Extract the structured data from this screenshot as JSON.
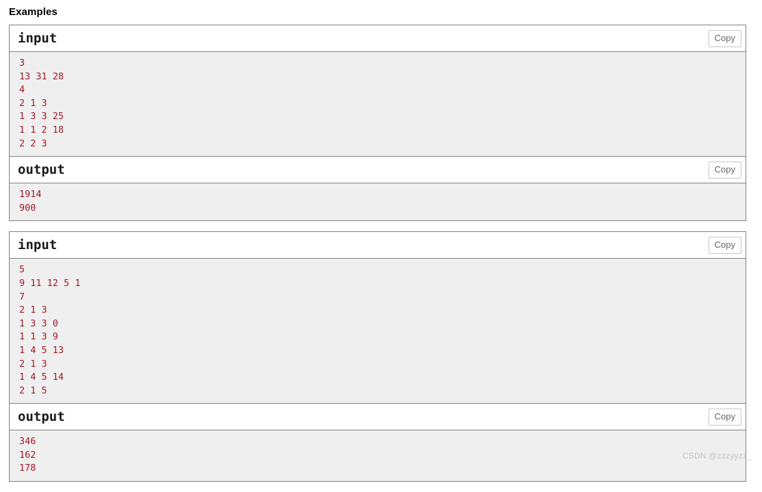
{
  "page": {
    "section_heading": "Examples",
    "watermark": "CSDN @zzzyyzz_"
  },
  "colors": {
    "code_text": "#a01a28",
    "pre_background": "#efefef",
    "panel_border": "#808080",
    "copy_border": "#c8c8c8",
    "copy_text": "#666666",
    "heading_text": "#000000",
    "watermark_text": "#c3c3c3"
  },
  "examples": [
    {
      "input": {
        "label": "input",
        "copy_label": "Copy",
        "content": "3\n13 31 28\n4\n2 1 3\n1 3 3 25\n1 1 2 18\n2 2 3"
      },
      "output": {
        "label": "output",
        "copy_label": "Copy",
        "content": "1914\n900"
      }
    },
    {
      "input": {
        "label": "input",
        "copy_label": "Copy",
        "content": "5\n9 11 12 5 1\n7\n2 1 3\n1 3 3 0\n1 1 3 9\n1 4 5 13\n2 1 3\n1 4 5 14\n2 1 5"
      },
      "output": {
        "label": "output",
        "copy_label": "Copy",
        "content": "346\n162\n178"
      }
    }
  ]
}
